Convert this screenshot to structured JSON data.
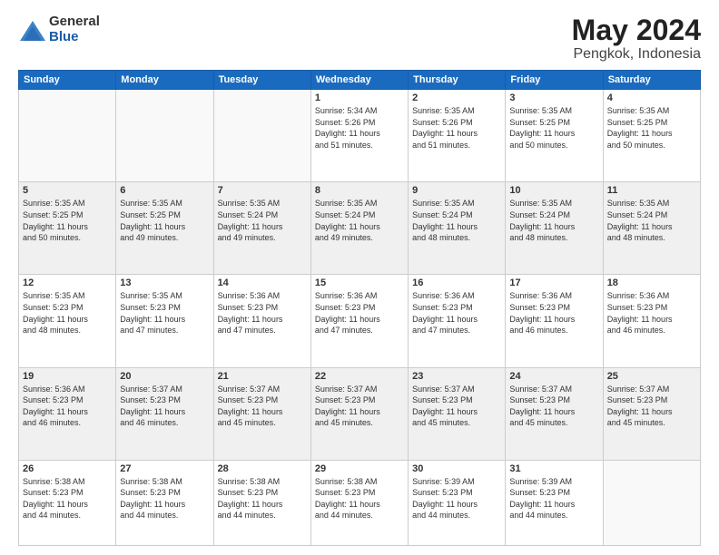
{
  "logo": {
    "general": "General",
    "blue": "Blue"
  },
  "title": {
    "month_year": "May 2024",
    "location": "Pengkok, Indonesia"
  },
  "weekdays": [
    "Sunday",
    "Monday",
    "Tuesday",
    "Wednesday",
    "Thursday",
    "Friday",
    "Saturday"
  ],
  "weeks": [
    [
      {
        "day": "",
        "info": ""
      },
      {
        "day": "",
        "info": ""
      },
      {
        "day": "",
        "info": ""
      },
      {
        "day": "1",
        "info": "Sunrise: 5:34 AM\nSunset: 5:26 PM\nDaylight: 11 hours\nand 51 minutes."
      },
      {
        "day": "2",
        "info": "Sunrise: 5:35 AM\nSunset: 5:26 PM\nDaylight: 11 hours\nand 51 minutes."
      },
      {
        "day": "3",
        "info": "Sunrise: 5:35 AM\nSunset: 5:25 PM\nDaylight: 11 hours\nand 50 minutes."
      },
      {
        "day": "4",
        "info": "Sunrise: 5:35 AM\nSunset: 5:25 PM\nDaylight: 11 hours\nand 50 minutes."
      }
    ],
    [
      {
        "day": "5",
        "info": "Sunrise: 5:35 AM\nSunset: 5:25 PM\nDaylight: 11 hours\nand 50 minutes."
      },
      {
        "day": "6",
        "info": "Sunrise: 5:35 AM\nSunset: 5:25 PM\nDaylight: 11 hours\nand 49 minutes."
      },
      {
        "day": "7",
        "info": "Sunrise: 5:35 AM\nSunset: 5:24 PM\nDaylight: 11 hours\nand 49 minutes."
      },
      {
        "day": "8",
        "info": "Sunrise: 5:35 AM\nSunset: 5:24 PM\nDaylight: 11 hours\nand 49 minutes."
      },
      {
        "day": "9",
        "info": "Sunrise: 5:35 AM\nSunset: 5:24 PM\nDaylight: 11 hours\nand 48 minutes."
      },
      {
        "day": "10",
        "info": "Sunrise: 5:35 AM\nSunset: 5:24 PM\nDaylight: 11 hours\nand 48 minutes."
      },
      {
        "day": "11",
        "info": "Sunrise: 5:35 AM\nSunset: 5:24 PM\nDaylight: 11 hours\nand 48 minutes."
      }
    ],
    [
      {
        "day": "12",
        "info": "Sunrise: 5:35 AM\nSunset: 5:23 PM\nDaylight: 11 hours\nand 48 minutes."
      },
      {
        "day": "13",
        "info": "Sunrise: 5:35 AM\nSunset: 5:23 PM\nDaylight: 11 hours\nand 47 minutes."
      },
      {
        "day": "14",
        "info": "Sunrise: 5:36 AM\nSunset: 5:23 PM\nDaylight: 11 hours\nand 47 minutes."
      },
      {
        "day": "15",
        "info": "Sunrise: 5:36 AM\nSunset: 5:23 PM\nDaylight: 11 hours\nand 47 minutes."
      },
      {
        "day": "16",
        "info": "Sunrise: 5:36 AM\nSunset: 5:23 PM\nDaylight: 11 hours\nand 47 minutes."
      },
      {
        "day": "17",
        "info": "Sunrise: 5:36 AM\nSunset: 5:23 PM\nDaylight: 11 hours\nand 46 minutes."
      },
      {
        "day": "18",
        "info": "Sunrise: 5:36 AM\nSunset: 5:23 PM\nDaylight: 11 hours\nand 46 minutes."
      }
    ],
    [
      {
        "day": "19",
        "info": "Sunrise: 5:36 AM\nSunset: 5:23 PM\nDaylight: 11 hours\nand 46 minutes."
      },
      {
        "day": "20",
        "info": "Sunrise: 5:37 AM\nSunset: 5:23 PM\nDaylight: 11 hours\nand 46 minutes."
      },
      {
        "day": "21",
        "info": "Sunrise: 5:37 AM\nSunset: 5:23 PM\nDaylight: 11 hours\nand 45 minutes."
      },
      {
        "day": "22",
        "info": "Sunrise: 5:37 AM\nSunset: 5:23 PM\nDaylight: 11 hours\nand 45 minutes."
      },
      {
        "day": "23",
        "info": "Sunrise: 5:37 AM\nSunset: 5:23 PM\nDaylight: 11 hours\nand 45 minutes."
      },
      {
        "day": "24",
        "info": "Sunrise: 5:37 AM\nSunset: 5:23 PM\nDaylight: 11 hours\nand 45 minutes."
      },
      {
        "day": "25",
        "info": "Sunrise: 5:37 AM\nSunset: 5:23 PM\nDaylight: 11 hours\nand 45 minutes."
      }
    ],
    [
      {
        "day": "26",
        "info": "Sunrise: 5:38 AM\nSunset: 5:23 PM\nDaylight: 11 hours\nand 44 minutes."
      },
      {
        "day": "27",
        "info": "Sunrise: 5:38 AM\nSunset: 5:23 PM\nDaylight: 11 hours\nand 44 minutes."
      },
      {
        "day": "28",
        "info": "Sunrise: 5:38 AM\nSunset: 5:23 PM\nDaylight: 11 hours\nand 44 minutes."
      },
      {
        "day": "29",
        "info": "Sunrise: 5:38 AM\nSunset: 5:23 PM\nDaylight: 11 hours\nand 44 minutes."
      },
      {
        "day": "30",
        "info": "Sunrise: 5:39 AM\nSunset: 5:23 PM\nDaylight: 11 hours\nand 44 minutes."
      },
      {
        "day": "31",
        "info": "Sunrise: 5:39 AM\nSunset: 5:23 PM\nDaylight: 11 hours\nand 44 minutes."
      },
      {
        "day": "",
        "info": ""
      }
    ]
  ]
}
